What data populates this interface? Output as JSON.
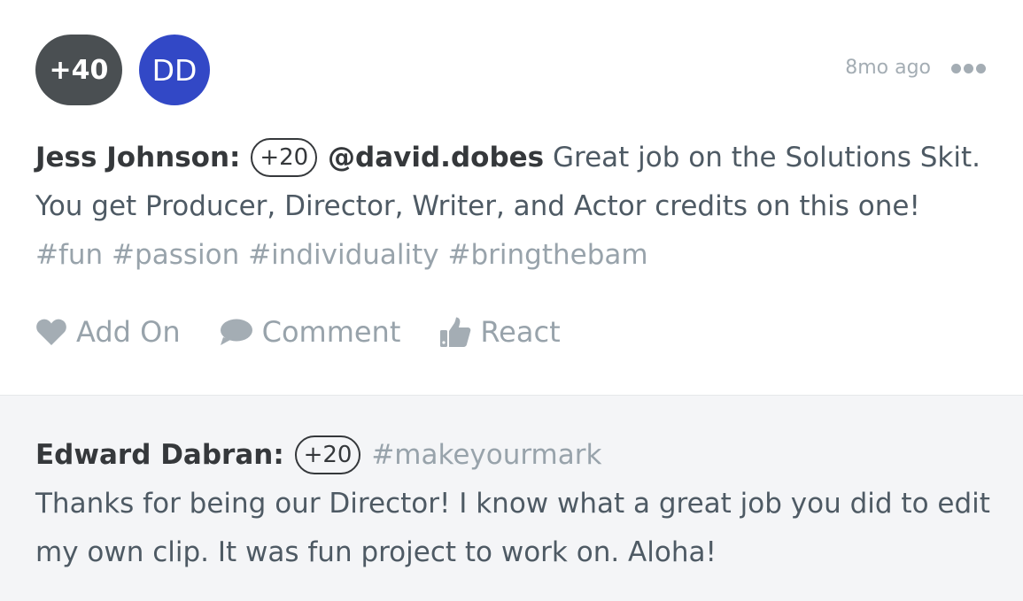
{
  "post": {
    "points_pill": "+40",
    "avatar_initials": "DD",
    "timestamp": "8mo ago",
    "more_icon": "ellipsis-icon",
    "author": "Jess Johnson:",
    "points": "+20",
    "mention": "@david.dobes",
    "message": "Great job on the Solutions Skit. You get Producer, Director, Writer, and Actor credits on this one!",
    "hashtags": [
      "#fun",
      "#passion",
      "#individuality",
      "#bringthebam"
    ],
    "colors": {
      "points_pill_bg": "#4a4f52",
      "avatar_bg": "#3248c6",
      "muted": "#98a3ab"
    }
  },
  "actions": [
    {
      "label": "Add On",
      "icon": "heart-icon"
    },
    {
      "label": "Comment",
      "icon": "speech-bubble-icon"
    },
    {
      "label": "React",
      "icon": "thumbs-up-icon"
    }
  ],
  "reply": {
    "author": "Edward Dabran:",
    "points": "+20",
    "hashtag": "#makeyourmark",
    "message": "Thanks for being our Director! I know what a great job you did to edit my own clip. It was fun project to work on. Aloha!",
    "background": "#f4f5f7"
  }
}
